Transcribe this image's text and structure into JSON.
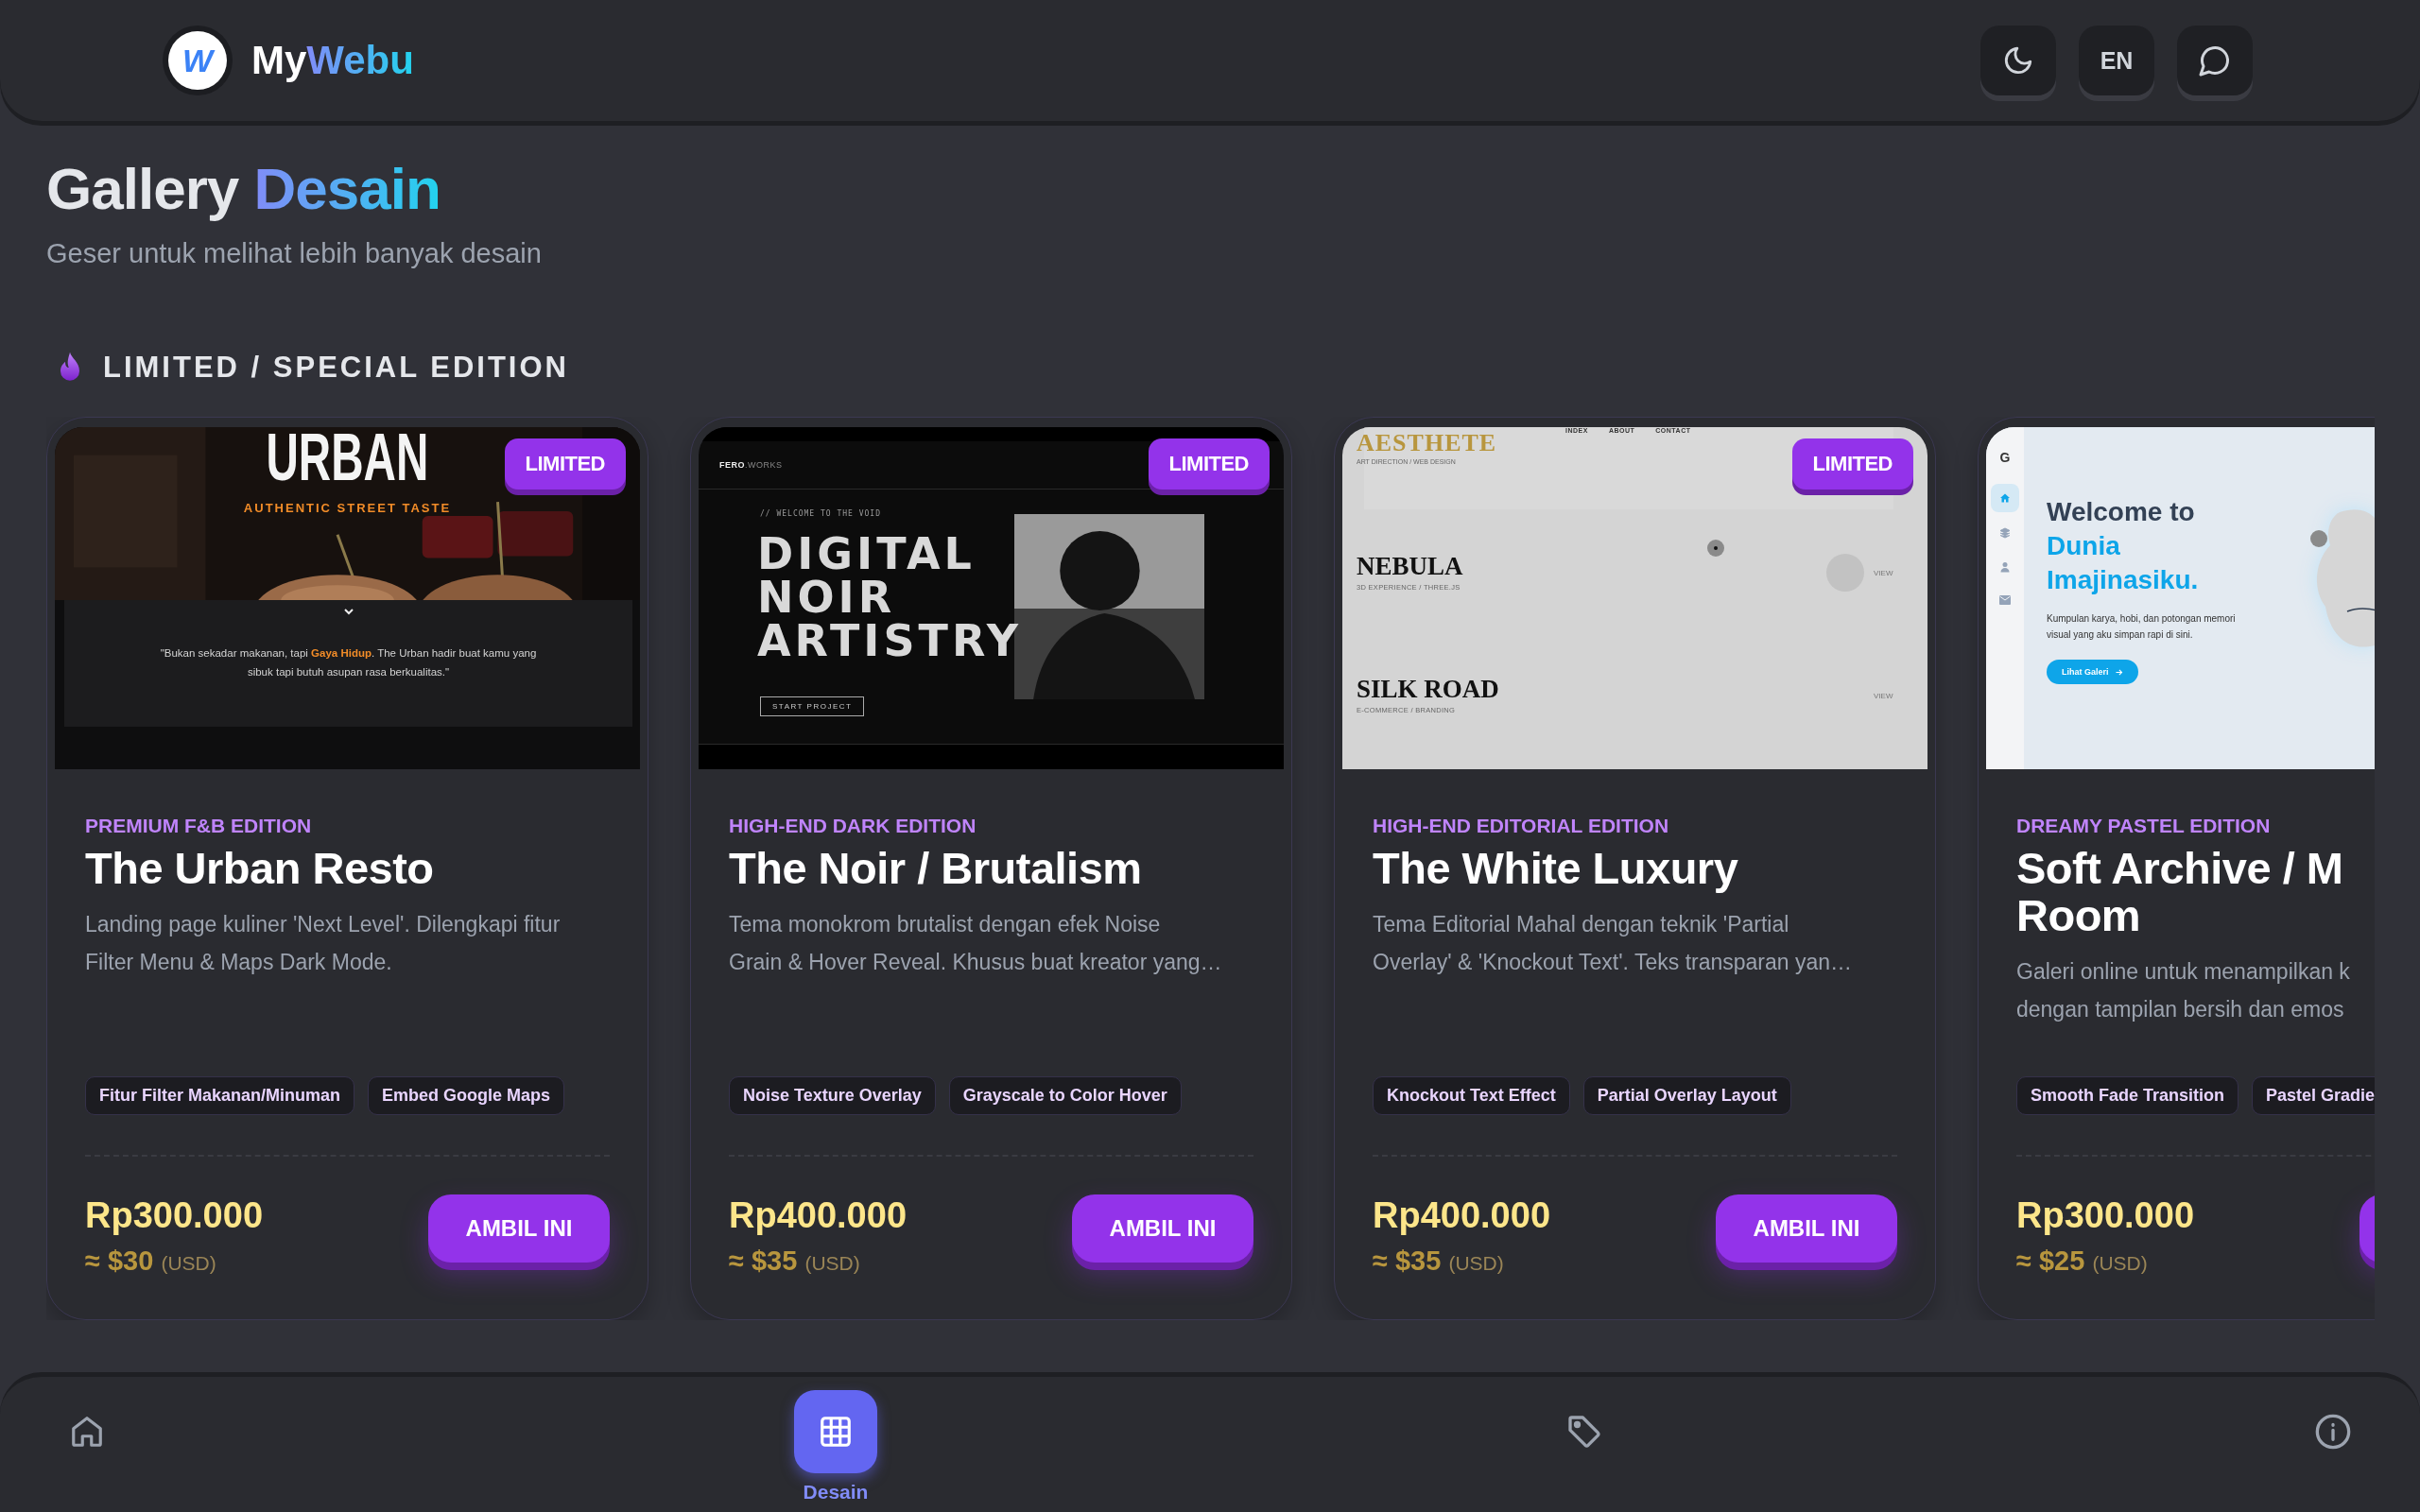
{
  "header": {
    "logo_mark": "W",
    "brand_first": "My",
    "brand_second": "Webu",
    "buttons": [
      {
        "kind": "theme"
      },
      {
        "kind": "language",
        "label": "EN"
      },
      {
        "kind": "chat"
      }
    ]
  },
  "page": {
    "title_first": "Gallery",
    "title_second": "Desain",
    "subtitle": "Geser untuk melihat lebih banyak desain"
  },
  "section": {
    "title": "LIMITED / SPECIAL EDITION"
  },
  "cards": [
    {
      "badge": "LIMITED",
      "edition": "PREMIUM F&B EDITION",
      "title": [
        "The Urban Resto"
      ],
      "description": [
        "Landing page kuliner 'Next Level'. Dilengkapi fitur",
        "Filter Menu & Maps Dark Mode."
      ],
      "tags": [
        "Fitur Filter Makanan/Minuman",
        "Embed Google Maps"
      ],
      "price": "Rp300.000",
      "usd": "≈ $30",
      "usd_unit": "(USD)",
      "button": "AMBIL INI",
      "preview": {
        "kind": "urban",
        "title": "URBAN",
        "tagline": "AUTHENTIC STREET TASTE",
        "quote": "\"Bukan sekadar makanan, tapi **Gaya Hidup**. The Urban hadir buat kamu yang sibuk tapi butuh asupan rasa berkualitas.\""
      }
    },
    {
      "badge": "LIMITED",
      "edition": "HIGH-END DARK EDITION",
      "title": [
        "The Noir / Brutalism"
      ],
      "description": [
        "Tema monokrom brutalist dengan efek Noise",
        "Grain & Hover Reveal. Khusus buat kreator yang…"
      ],
      "tags": [
        "Noise Texture Overlay",
        "Grayscale to Color Hover"
      ],
      "price": "Rp400.000",
      "usd": "≈ $35",
      "usd_unit": "(USD)",
      "button": "AMBIL INI",
      "preview": {
        "kind": "noir",
        "logo": "**FERO**.WORKS",
        "eyebrow": "// WELCOME TO THE VOID",
        "headline": [
          "DIGITAL",
          "NOIR",
          "ARTISTRY"
        ],
        "cta": "START PROJECT"
      }
    },
    {
      "badge": "LIMITED",
      "edition": "HIGH-END EDITORIAL EDITION",
      "title": [
        "The White Luxury"
      ],
      "description": [
        "Tema Editorial Mahal dengan teknik 'Partial",
        "Overlay' & 'Knockout Text'. Teks transparan yan…"
      ],
      "tags": [
        "Knockout Text Effect",
        "Partial Overlay Layout"
      ],
      "price": "Rp400.000",
      "usd": "≈ $35",
      "usd_unit": "(USD)",
      "button": "AMBIL INI",
      "preview": {
        "kind": "editorial",
        "brand": "AESTHETE",
        "brand_sub": "ART DIRECTION / WEB DESIGN",
        "nav": [
          "INDEX",
          "ABOUT",
          "CONTACT"
        ],
        "projects": [
          {
            "name": "NEBULA",
            "meta": "3D EXPERIENCE / THREE.JS",
            "link": "VIEW"
          },
          {
            "name": "SILK ROAD",
            "meta": "E-COMMERCE / BRANDING",
            "link": "VIEW"
          }
        ]
      }
    },
    {
      "edition": "DREAMY PASTEL EDITION",
      "title": [
        "Soft Archive / M",
        "Room"
      ],
      "description": [
        "Galeri online untuk menampilkan k",
        "dengan tampilan bersih dan emos"
      ],
      "tags": [
        "Smooth Fade Transition",
        "Pastel Gradie"
      ],
      "price": "Rp300.000",
      "usd": "≈ $25",
      "usd_unit": "(USD)",
      "preview": {
        "kind": "pastel",
        "mark": "G",
        "heading_first": "Welcome to",
        "heading_second": [
          "Dunia",
          "Imajinasiku."
        ],
        "text": [
          "Kumpulan karya, hobi, dan potongan memori",
          "visual yang aku simpan rapi di sini."
        ],
        "cta": "Lihat Galeri"
      }
    }
  ],
  "nav": {
    "items": [
      {
        "kind": "home",
        "selected": false
      },
      {
        "kind": "grid",
        "label": "Desain",
        "selected": true
      },
      {
        "kind": "tag",
        "selected": false
      },
      {
        "kind": "info",
        "selected": false
      }
    ]
  }
}
